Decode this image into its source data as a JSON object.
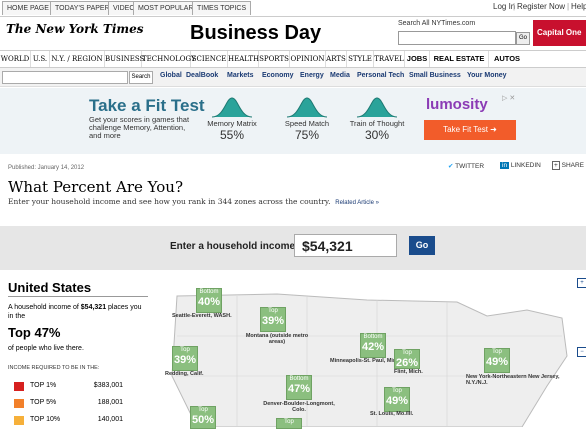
{
  "top_tabs": [
    "HOME PAGE",
    "TODAY'S PAPER",
    "VIDEO",
    "MOST POPULAR",
    "TIMES TOPICS"
  ],
  "top_right": {
    "login": "Log In",
    "register": "Register Now",
    "help": "Help"
  },
  "header": {
    "logo": "The New York Times",
    "section": "Business Day",
    "search_label": "Search All NYTimes.com",
    "search_go": "Go",
    "sponsor": "Capital One"
  },
  "nav": [
    "WORLD",
    "U.S.",
    "N.Y. / REGION",
    "BUSINESS",
    "TECHNOLOGY",
    "SCIENCE",
    "HEALTH",
    "SPORTS",
    "OPINION",
    "ARTS",
    "STYLE",
    "TRAVEL",
    "JOBS",
    "REAL ESTATE",
    "AUTOS"
  ],
  "subnav": {
    "search_button": "Search",
    "links": [
      "Global",
      "DealBook",
      "Markets",
      "Economy",
      "Energy",
      "Media",
      "Personal Tech",
      "Small Business",
      "Your Money"
    ]
  },
  "ad": {
    "title": "Take a Fit Test",
    "subtitle": "Get your scores in games that challenge Memory, Attention, and more",
    "metrics": [
      {
        "label": "Memory Matrix",
        "value": "55%"
      },
      {
        "label": "Speed Match",
        "value": "75%"
      },
      {
        "label": "Train of Thought",
        "value": "30%"
      }
    ],
    "brand": "lumosity",
    "cta": "Take Fit Test ➜",
    "adchoices": "▷ ✕"
  },
  "article": {
    "published": "Published: January 14, 2012",
    "share": [
      "TWITTER",
      "LINKEDIN",
      "SHARE"
    ],
    "headline": "What Percent Are You?",
    "dek": "Enter your household income and see how you rank in 344 zones across the country.",
    "related": "Related Article »"
  },
  "income": {
    "label": "Enter a household income",
    "value": "$54,321",
    "go": "Go"
  },
  "panel": {
    "country": "United States",
    "line1_prefix": "A household income of ",
    "line1_value": "$54,321",
    "line1_suffix": " places you in the",
    "top_pct": "Top 47%",
    "line2": "of people who live there.",
    "required_header": "INCOME REQUIRED TO BE IN THE:",
    "brackets": [
      {
        "label": "TOP 1%",
        "value": "$383,001",
        "color": "#d6201f"
      },
      {
        "label": "TOP 5%",
        "value": "188,001",
        "color": "#f2802a"
      },
      {
        "label": "TOP 10%",
        "value": "140,001",
        "color": "#f6b03a"
      }
    ]
  },
  "map": {
    "labels": [
      {
        "kind": "Bottom",
        "value": "40%",
        "city": "Seattle-Everett, WASH."
      },
      {
        "kind": "Top",
        "value": "39%",
        "city": "Montana (outside metro areas)"
      },
      {
        "kind": "Top",
        "value": "39%",
        "city": "Redding, Calif."
      },
      {
        "kind": "Bottom",
        "value": "42%",
        "city": "Minneapolis-St. Paul, Minn."
      },
      {
        "kind": "Top",
        "value": "26%",
        "city": "Flint, Mich."
      },
      {
        "kind": "Top",
        "value": "49%",
        "city": "New York-Northeastern New Jersey, N.Y./N.J."
      },
      {
        "kind": "Bottom",
        "value": "47%",
        "city": "Denver-Boulder-Longmont, Colo."
      },
      {
        "kind": "Top",
        "value": "49%",
        "city": "St. Louis, Mo./Ill."
      },
      {
        "kind": "Top",
        "value": "50%",
        "city": ""
      },
      {
        "kind": "Top",
        "value": "",
        "city": ""
      }
    ]
  },
  "colors": {
    "map_green": "#8bbf7f",
    "nyt_blue": "#1a4c8c",
    "ad_orange": "#f25c2a"
  }
}
